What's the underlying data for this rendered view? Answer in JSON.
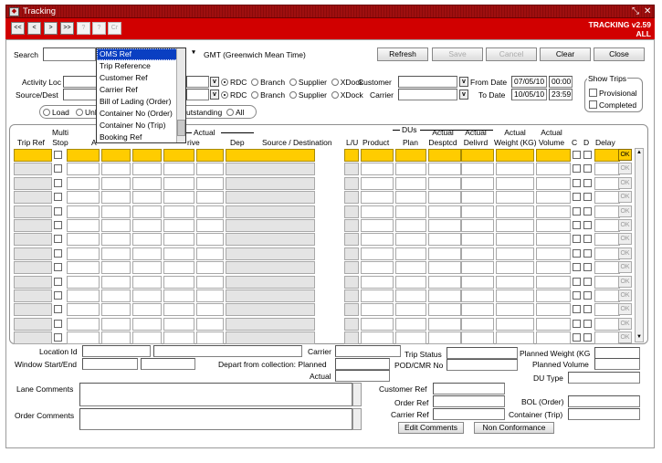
{
  "window": {
    "title": "Tracking",
    "version": "TRACKING v2.59",
    "mode": "ALL"
  },
  "nav": [
    "<<",
    "<",
    ">",
    ">>",
    "?",
    "?",
    "Cr"
  ],
  "search": {
    "label": "Search",
    "timezone": "GMT (Greenwich Mean Time)"
  },
  "buttons": {
    "refresh": "Refresh",
    "save": "Save",
    "cancel": "Cancel",
    "clear": "Clear",
    "close": "Close"
  },
  "dropdown": {
    "items": [
      "OMS Ref",
      "Trip Reference",
      "Customer Ref",
      "Carrier Ref",
      "Bill of Lading (Order)",
      "Container No (Order)",
      "Container No (Trip)",
      "Booking Ref"
    ],
    "selected": "OMS Ref"
  },
  "filters": {
    "activity_loc": "Activity Loc",
    "source_dest": "Source/Dest",
    "radio_options": [
      "RDC",
      "Branch",
      "Supplier",
      "XDock"
    ],
    "customer": "Customer",
    "carrier": "Carrier",
    "from_date_label": "From Date",
    "from_date": "07/05/10",
    "from_time": "00:00",
    "to_date_label": "To Date",
    "to_date": "10/05/10",
    "to_time": "23:59",
    "load_options": [
      "Load",
      "Unl",
      "utstanding",
      "All"
    ],
    "show_trips": "Show Trips",
    "provisional": "Provisional",
    "completed": "Completed",
    "v": "v"
  },
  "grid": {
    "headers": {
      "trip_ref": "Trip Ref",
      "multi": "Multi",
      "stop": "Stop",
      "a": "A",
      "rive": "rive",
      "actual_group": "Actual",
      "dep": "Dep",
      "source_dest": "Source / Destination",
      "lu": "L/U",
      "product": "Product",
      "dus": "DUs",
      "plan": "Plan",
      "actual": "Actual",
      "desptcd": "Desptcd",
      "delivrd": "Delivrd",
      "actual_weight": "Weight (KG)",
      "actual_volume": "Volume",
      "c": "C",
      "d": "D",
      "delay": "Delay"
    },
    "ok": "OK"
  },
  "detail": {
    "location_id": "Location Id",
    "window": "Window Start/End",
    "carrier": "Carrier",
    "depart_planned": "Depart from collection: Planned",
    "actual": "Actual",
    "trip_status": "Trip Status",
    "pod_cmr": "POD/CMR No",
    "planned_weight": "Planned Weight (KG",
    "planned_volume": "Planned Volume",
    "du_type": "DU Type",
    "lane_comments": "Lane Comments",
    "order_comments": "Order Comments",
    "customer_ref": "Customer Ref",
    "order_ref": "Order Ref",
    "carrier_ref": "Carrier Ref",
    "bol_order": "BOL (Order)",
    "container_trip": "Container (Trip)",
    "edit_comments": "Edit Comments",
    "non_conformance": "Non Conformance"
  }
}
